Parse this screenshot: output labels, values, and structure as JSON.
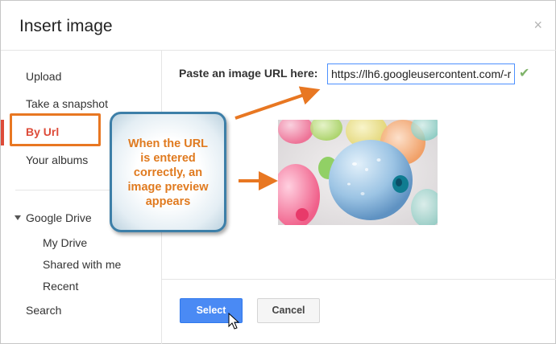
{
  "dialog": {
    "title": "Insert image",
    "close_glyph": "×"
  },
  "sidebar": {
    "items": [
      {
        "label": "Upload"
      },
      {
        "label": "Take a snapshot"
      },
      {
        "label": "By Url"
      },
      {
        "label": "Your albums"
      }
    ],
    "drive": {
      "label": "Google Drive",
      "children": [
        {
          "label": "My Drive"
        },
        {
          "label": "Shared with me"
        },
        {
          "label": "Recent"
        }
      ]
    },
    "search_label": "Search"
  },
  "url_panel": {
    "label": "Paste an image URL here:",
    "value": "https://lh6.googleusercontent.com/-r"
  },
  "callout": {
    "text": "When the URL is entered correctly, an image preview appears"
  },
  "buttons": {
    "select": "Select",
    "cancel": "Cancel"
  },
  "colors": {
    "accent_red": "#dd4b39",
    "annotation_orange": "#e87722",
    "primary_blue": "#4a8af4",
    "callout_border": "#3d7fa8"
  },
  "icons": {
    "close": "close-icon",
    "check": "check-icon",
    "expand": "triangle-down-icon",
    "cursor": "mouse-pointer-icon"
  }
}
